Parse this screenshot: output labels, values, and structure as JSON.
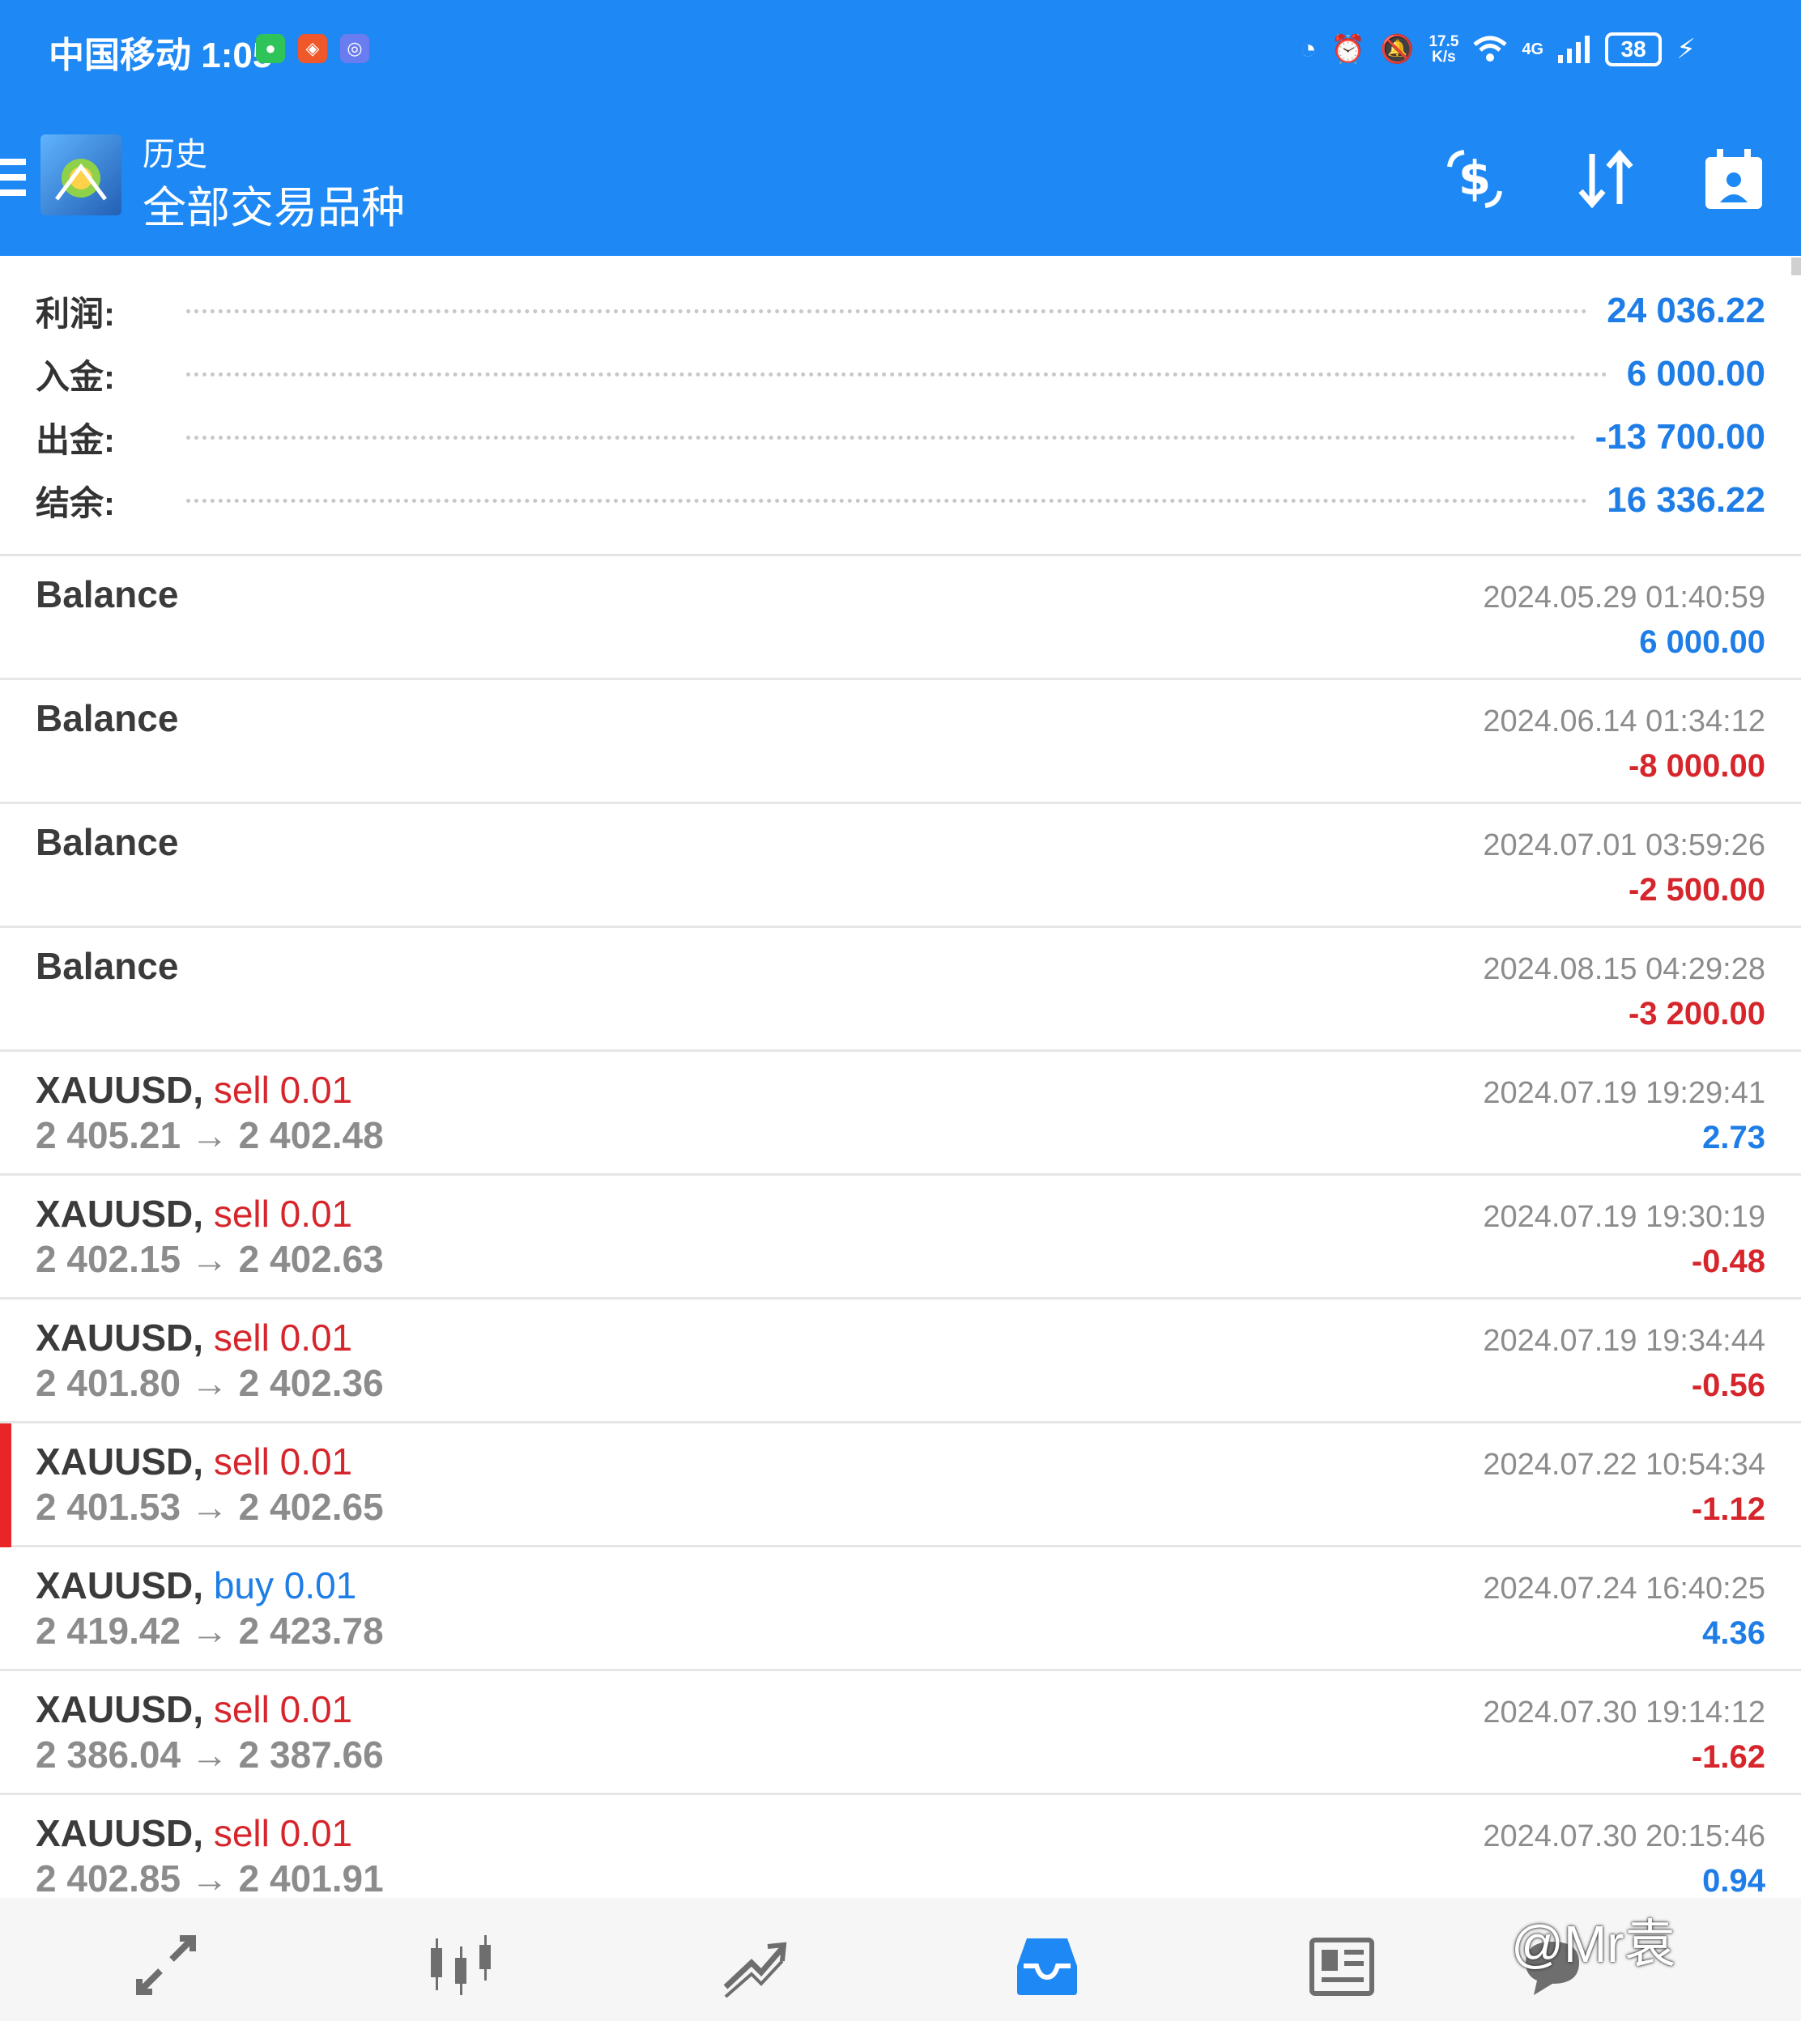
{
  "status_bar": {
    "carrier_time": "中国移动 1:05",
    "speed_value": "17.5",
    "speed_unit": "K/s",
    "network": "4G",
    "battery": "38"
  },
  "header": {
    "title": "历史",
    "subtitle": "全部交易品种"
  },
  "summary": [
    {
      "label": "利润:",
      "value": "24 036.22"
    },
    {
      "label": "入金:",
      "value": "6 000.00"
    },
    {
      "label": "出金:",
      "value": "-13 700.00"
    },
    {
      "label": "结余:",
      "value": "16 336.22"
    }
  ],
  "rows": [
    {
      "title": "Balance",
      "date": "2024.05.29 01:40:59",
      "amount": "6 000.00"
    },
    {
      "title": "Balance",
      "date": "2024.06.14 01:34:12",
      "amount": "-8 000.00"
    },
    {
      "title": "Balance",
      "date": "2024.07.01 03:59:26",
      "amount": "-2 500.00"
    },
    {
      "title": "Balance",
      "date": "2024.08.15 04:29:28",
      "amount": "-3 200.00"
    },
    {
      "symbol": "XAUUSD,",
      "side": "sell 0.01",
      "prices": "2 405.21 → 2 402.48",
      "date": "2024.07.19 19:29:41",
      "amount": "2.73"
    },
    {
      "symbol": "XAUUSD,",
      "side": "sell 0.01",
      "prices": "2 402.15 → 2 402.63",
      "date": "2024.07.19 19:30:19",
      "amount": "-0.48"
    },
    {
      "symbol": "XAUUSD,",
      "side": "sell 0.01",
      "prices": "2 401.80 → 2 402.36",
      "date": "2024.07.19 19:34:44",
      "amount": "-0.56"
    },
    {
      "symbol": "XAUUSD,",
      "side": "sell 0.01",
      "prices": "2 401.53 → 2 402.65",
      "date": "2024.07.22 10:54:34",
      "amount": "-1.12"
    },
    {
      "symbol": "XAUUSD,",
      "side": "buy 0.01",
      "prices": "2 419.42 → 2 423.78",
      "date": "2024.07.24 16:40:25",
      "amount": "4.36"
    },
    {
      "symbol": "XAUUSD,",
      "side": "sell 0.01",
      "prices": "2 386.04 → 2 387.66",
      "date": "2024.07.30 19:14:12",
      "amount": "-1.62"
    },
    {
      "symbol": "XAUUSD,",
      "side": "sell 0.01",
      "prices": "2 402.85 → 2 401.91",
      "date": "2024.07.30 20:15:46",
      "amount": "0.94"
    }
  ],
  "colors": {
    "accent": "#1e88f5",
    "positive": "#1e7de6",
    "negative": "#d6252b",
    "selected_marker": "#e8262a"
  },
  "icons": {
    "header": [
      "currency-exchange-icon",
      "sort-icon",
      "add-report-icon"
    ],
    "nav": [
      "quotes-icon",
      "chart-icon",
      "trade-icon",
      "history-icon",
      "news-icon",
      "chat-icon"
    ]
  },
  "watermark": "@Mr袁"
}
